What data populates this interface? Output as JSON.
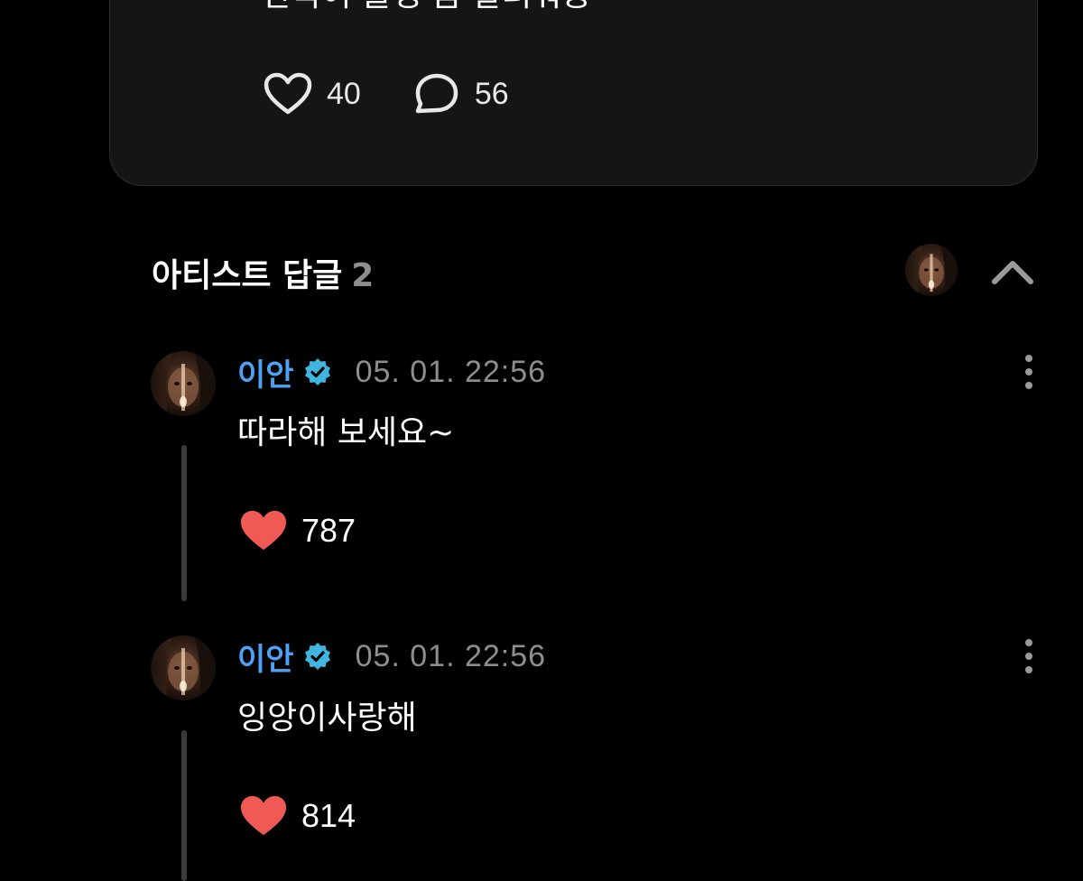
{
  "post": {
    "text": "한국어 슬랭 좀 알려줘용",
    "like_count": "40",
    "comment_count": "56"
  },
  "artist_replies": {
    "title": "아티스트 답글",
    "count": "2"
  },
  "replies": [
    {
      "author": "이안",
      "time": "05. 01. 22:56",
      "text": "따라해 보세요~",
      "like_count": "787"
    },
    {
      "author": "이안",
      "time": "05. 01. 22:56",
      "text": "잉앙이사랑해",
      "like_count": "814"
    }
  ],
  "colors": {
    "accent_name": "#4ea2f5",
    "verified_badge": "#3fb5e0",
    "liked_heart": "#ef5a55",
    "card_bg": "#151515",
    "muted": "#8e8e8e"
  },
  "icons": {
    "like": "heart-outline-icon",
    "comment": "speech-bubble-icon",
    "verified": "verified-badge-icon",
    "collapse": "chevron-up-icon",
    "more": "more-vertical-icon",
    "liked": "heart-filled-icon"
  }
}
